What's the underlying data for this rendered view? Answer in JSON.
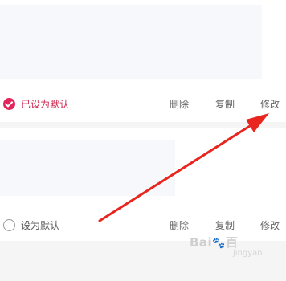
{
  "addresses": [
    {
      "default_label": "已设为默认",
      "is_default": true,
      "actions": {
        "delete": "删除",
        "copy": "复制",
        "edit": "修改"
      }
    },
    {
      "default_label": "设为默认",
      "is_default": false,
      "actions": {
        "delete": "删除",
        "copy": "复制",
        "edit": "修改"
      }
    }
  ],
  "watermark": {
    "brand_left": "Bai",
    "brand_right": "百",
    "sub": "jingyan"
  },
  "colors": {
    "accent": "#e2265c",
    "arrow": "#e8261f",
    "muted_text": "#666666"
  }
}
